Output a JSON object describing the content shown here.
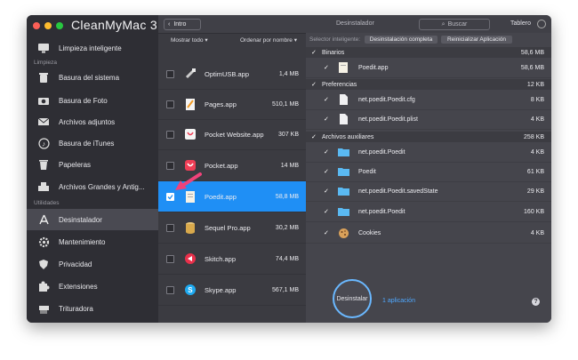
{
  "app": {
    "name": "CleanMyMac 3"
  },
  "sidebar": {
    "top_item": "Limpieza inteligente",
    "section1": "Limpieza",
    "items1": [
      "Basura del sistema",
      "Basura de Foto",
      "Archivos adjuntos",
      "Basura de iTunes",
      "Papeleras",
      "Archivos Grandes y Antig..."
    ],
    "section2": "Utilidades",
    "items2": [
      "Desinstalador",
      "Mantenimiento",
      "Privacidad",
      "Extensiones",
      "Trituradora"
    ]
  },
  "toolbar": {
    "back_label": "Intro",
    "title": "Desinstalador",
    "search_placeholder": "Buscar",
    "dashboard_label": "Tablero"
  },
  "list_header": {
    "filter": "Mostrar todo",
    "sort": "Ordenar por nombre"
  },
  "apps": [
    {
      "name": "OptimUSB.app",
      "size": "1,4 MB"
    },
    {
      "name": "Pages.app",
      "size": "510,1 MB"
    },
    {
      "name": "Pocket Website.app",
      "size": "307 KB"
    },
    {
      "name": "Pocket.app",
      "size": "14 MB"
    },
    {
      "name": "Poedit.app",
      "size": "58,8 MB"
    },
    {
      "name": "Sequel Pro.app",
      "size": "30,2 MB"
    },
    {
      "name": "Skitch.app",
      "size": "74,4 MB"
    },
    {
      "name": "Skype.app",
      "size": "567,1 MB"
    }
  ],
  "smart": {
    "label": "Selector inteligente:",
    "full": "Desinstalación completa",
    "reset": "Reinicializar Aplicación"
  },
  "groups": [
    {
      "name": "Binarios",
      "size": "58,6 MB",
      "files": [
        {
          "name": "Poedit.app",
          "size": "58,6 MB"
        }
      ]
    },
    {
      "name": "Preferencias",
      "size": "12 KB",
      "files": [
        {
          "name": "net.poedit.Poedit.cfg",
          "size": "8 KB"
        },
        {
          "name": "net.poedit.Poedit.plist",
          "size": "4 KB"
        }
      ]
    },
    {
      "name": "Archivos auxiliares",
      "size": "258 KB",
      "files": [
        {
          "name": "net.poedit.Poedit",
          "size": "4 KB"
        },
        {
          "name": "Poedit",
          "size": "61 KB"
        },
        {
          "name": "net.poedit.Poedit.savedState",
          "size": "29 KB"
        },
        {
          "name": "net.poedit.Poedit",
          "size": "160 KB"
        },
        {
          "name": "Cookies",
          "size": "4 KB"
        }
      ]
    }
  ],
  "footer": {
    "uninstall": "Desinstalar",
    "count": "1 aplicación"
  },
  "colors": {
    "accent": "#1f8ff5",
    "arrow": "#f0427a"
  }
}
